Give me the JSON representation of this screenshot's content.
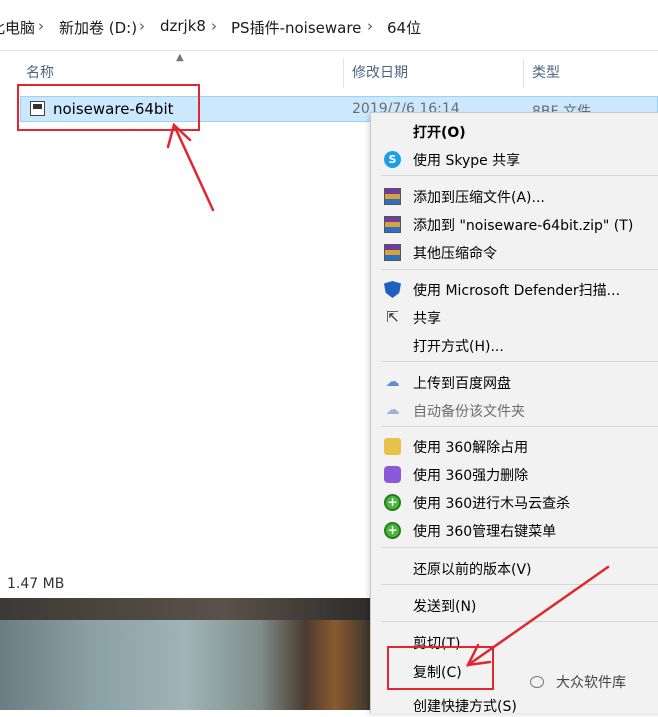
{
  "breadcrumb": {
    "items": [
      "此电脑",
      "新加卷 (D:)",
      "dzrjk8",
      "PS插件-noiseware",
      "64位"
    ],
    "separator": "›"
  },
  "columns": {
    "name": "名称",
    "date": "修改日期",
    "type": "类型"
  },
  "file": {
    "name": "noiseware-64bit",
    "date": "2019/7/6 16:14",
    "type": "8BF 文件",
    "icon": "plugin-file-icon"
  },
  "status": {
    "size": "1.47 MB"
  },
  "context_menu": {
    "items": [
      {
        "label": "打开(O)",
        "icon": "",
        "bold": true
      },
      {
        "label": "使用 Skype 共享",
        "icon": "skype-icon"
      },
      {
        "label": "添加到压缩文件(A)...",
        "icon": "winrar-icon"
      },
      {
        "label": "添加到 \"noiseware-64bit.zip\" (T)",
        "icon": "winrar-icon"
      },
      {
        "label": "其他压缩命令",
        "icon": "winrar-icon"
      },
      {
        "label": "使用 Microsoft Defender扫描...",
        "icon": "defender-shield-icon"
      },
      {
        "label": "共享",
        "icon": "share-icon"
      },
      {
        "label": "打开方式(H)...",
        "icon": ""
      },
      {
        "label": "上传到百度网盘",
        "icon": "baidu-cloud-icon"
      },
      {
        "label": "自动备份该文件夹",
        "icon": "baidu-cloud-icon",
        "dim": true
      },
      {
        "label": "使用 360解除占用",
        "icon": "360-unlock-icon"
      },
      {
        "label": "使用 360强力删除",
        "icon": "360-delete-icon"
      },
      {
        "label": "使用 360进行木马云查杀",
        "icon": "360-scan-icon"
      },
      {
        "label": "使用 360管理右键菜单",
        "icon": "360-menu-icon"
      },
      {
        "label": "还原以前的版本(V)",
        "icon": ""
      },
      {
        "label": "发送到(N)",
        "icon": ""
      },
      {
        "label": "剪切(T)",
        "icon": ""
      },
      {
        "label": "复制(C)",
        "icon": ""
      },
      {
        "label": "创建快捷方式(S)",
        "icon": ""
      }
    ]
  },
  "watermark": {
    "text": "大众软件库"
  },
  "colors": {
    "highlight": "#e0262f",
    "selection": "#cce8ff"
  }
}
